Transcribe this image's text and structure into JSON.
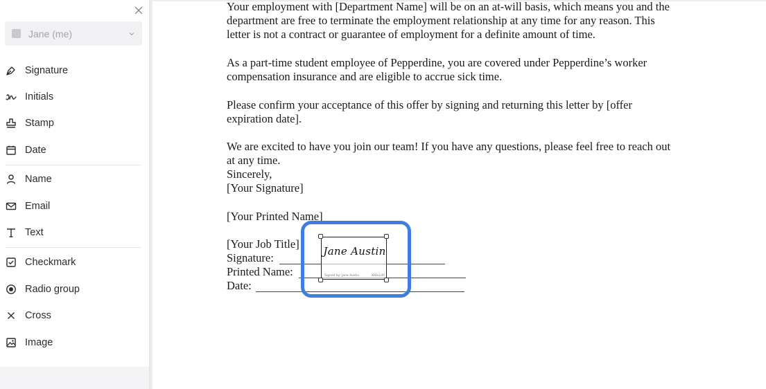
{
  "sidebar": {
    "recipient": {
      "name": "Jane (me)"
    },
    "fields": [
      {
        "label": "Signature",
        "icon": "pen-nib-icon"
      },
      {
        "label": "Initials",
        "icon": "initials-icon"
      },
      {
        "label": "Stamp",
        "icon": "stamp-icon"
      },
      {
        "label": "Date",
        "icon": "calendar-icon"
      },
      {
        "label": "Name",
        "icon": "person-icon"
      },
      {
        "label": "Email",
        "icon": "envelope-icon"
      },
      {
        "label": "Text",
        "icon": "text-t-icon"
      },
      {
        "label": "Checkmark",
        "icon": "checkbox-icon"
      },
      {
        "label": "Radio group",
        "icon": "radio-icon"
      },
      {
        "label": "Cross",
        "icon": "x-mark-icon"
      },
      {
        "label": "Image",
        "icon": "image-icon"
      }
    ]
  },
  "document": {
    "para1": [
      "Your employment with [Department Name] will be on an at-will basis, which means you and the",
      "department are free to terminate the employment relationship at any time for any reason. This",
      "letter is not a contract or guarantee of employment for a definite amount of time."
    ],
    "para2": [
      "As a part-time student employee of Pepperdine, you are covered under Pepperdine’s worker",
      "compensation insurance and are eligible to accrue sick time."
    ],
    "para3": [
      "Please confirm your acceptance of this offer by signing and returning this letter by [offer",
      "expiration date]."
    ],
    "para4": [
      "We are excited to have you join our team! If you have any questions, please feel free to reach out",
      "at any time.",
      "Sincerely,",
      "[Your Signature]"
    ],
    "printed_name_placeholder": "[Your Printed Name]",
    "job_title_placeholder": "[Your Job Title]",
    "signature_label": "Signature:",
    "printed_name_label": "Printed Name:",
    "date_label": "Date:"
  },
  "signature_field": {
    "signature_text": "Jane Austin",
    "meta_left": "Signed by: Jane Austin",
    "meta_right": "300x140"
  },
  "colors": {
    "highlight": "#3d7ee0"
  }
}
